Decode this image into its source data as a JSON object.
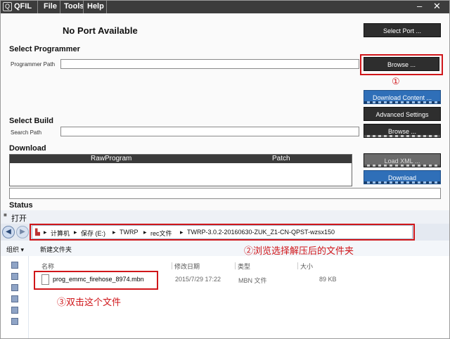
{
  "titlebar": {
    "logo": "Q",
    "app_name": "QFIL",
    "menu": [
      "File",
      "Tools",
      "Help"
    ],
    "minimize": "–",
    "close": "✕"
  },
  "qfil": {
    "port_status": "No Port Available",
    "select_port_label": "Select Port ...",
    "select_programmer_heading": "Select Programmer",
    "programmer_path_label": "Programmer Path",
    "browse_label": "Browse ...",
    "download_content_label": "Download Content ...",
    "advanced_settings_label": "Advanced Settings",
    "select_build_heading": "Select Build",
    "search_path_label": "Search Path",
    "browse2_label": "Browse ...",
    "download_heading": "Download",
    "grid_columns": [
      "RawProgram",
      "Patch"
    ],
    "load_xml_label": "Load XML ...",
    "download_label": "Download",
    "status_heading": "Status"
  },
  "annotations": {
    "step1": "①",
    "step2": "②浏览选择解压后的文件夹",
    "step3": "③双击这个文件"
  },
  "dialog": {
    "title": "打开",
    "back_icon": "◀",
    "forward_icon": "▶",
    "breadcrumbs": [
      "计算机",
      "保存 (E:)",
      "TWRP",
      "rec文件",
      "TWRP-3.0.2-20160630-ZUK_Z1-CN-QPST-wzsx150"
    ],
    "separators": [
      "▸",
      "▸",
      "▸",
      "▸",
      "▸"
    ],
    "organize_label": "组织 ▾",
    "new_folder_label": "新建文件夹",
    "columns": [
      "名称",
      "修改日期",
      "类型",
      "大小"
    ],
    "file": {
      "name": "prog_emmc_firehose_8974.mbn",
      "date": "2015/7/29 17:22",
      "type": "MBN 文件",
      "size": "89 KB"
    }
  },
  "colors": {
    "annotation_red": "#d0161a",
    "button_dark": "#2e2e2e",
    "button_blue": "#2f6fb8"
  }
}
